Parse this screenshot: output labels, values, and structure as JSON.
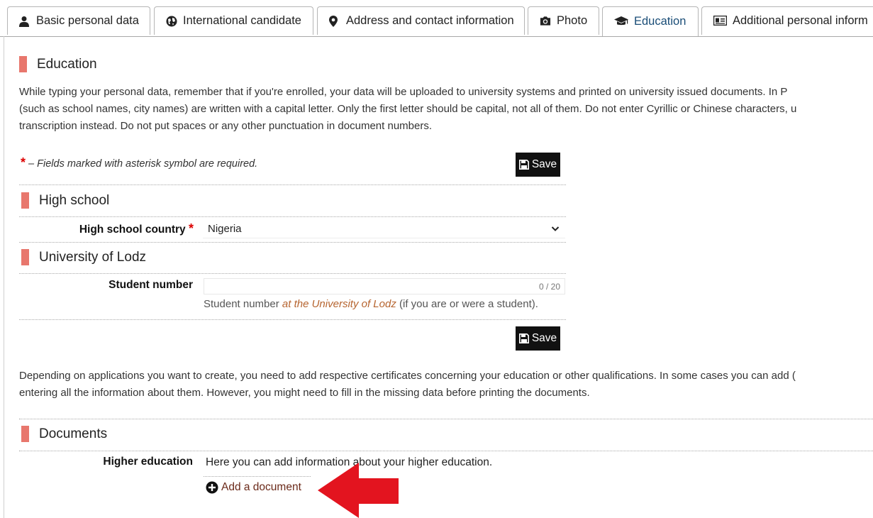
{
  "tabs": [
    {
      "label": "Basic personal data",
      "icon": "user-icon"
    },
    {
      "label": "International candidate",
      "icon": "globe-icon"
    },
    {
      "label": "Address and contact information",
      "icon": "map-marker-icon"
    },
    {
      "label": "Photo",
      "icon": "camera-icon"
    },
    {
      "label": "Education",
      "icon": "graduation-cap-icon",
      "active": true
    },
    {
      "label": "Additional personal inform",
      "icon": "id-card-icon"
    }
  ],
  "page": {
    "title": "Education",
    "intro": [
      "While typing your personal data, remember that if you're enrolled, your data will be uploaded to university systems and printed on university issued documents. In P",
      "(such as school names, city names) are written with a capital letter. Only the first letter should be capital, not all of them. Do not enter Cyrillic or Chinese characters, u",
      "transcription instead. Do not put spaces or any other punctuation in document numbers."
    ],
    "required_star": "*",
    "required_note": "– Fields marked with asterisk symbol are required.",
    "save_label": "Save"
  },
  "high_school": {
    "section_title": "High school",
    "country_label": "High school country",
    "country_value": "Nigeria"
  },
  "university": {
    "section_title": "University of Lodz",
    "student_number_label": "Student number",
    "student_number_value": "",
    "char_counter": "0 / 20",
    "hint_prefix": "Student number ",
    "hint_emph": "at the University of Lodz",
    "hint_suffix": " (if you are or were a student)."
  },
  "certificates_note": [
    "Depending on applications you want to create, you need to add respective certificates concerning your education or other qualifications. In some cases you can add (",
    "entering all the information about them. However, you might need to fill in the missing data before printing the documents."
  ],
  "documents": {
    "section_title": "Documents",
    "higher_education_label": "Higher education",
    "higher_education_text": "Here you can add information about your higher education.",
    "add_document_label": "Add a document"
  },
  "colors": {
    "section_bar": "#e8776d",
    "arrow": "#e3141f",
    "active_tab_text": "#1a4d77",
    "link": "#6b2a1a",
    "hint_emphasis": "#b6642f"
  }
}
